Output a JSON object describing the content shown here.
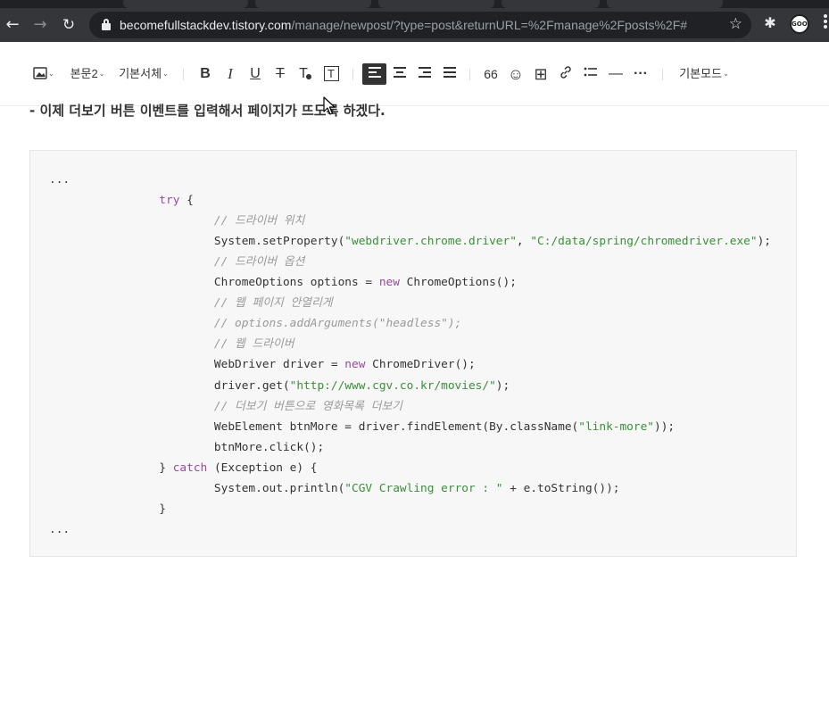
{
  "browser": {
    "url_host": "becomefullstackdev.tistory.com",
    "url_path": "/manage/newpost/?type=post&returnURL=%2Fmanage%2Fposts%2F#",
    "profile_label": "GOOD",
    "icons": {
      "back": "back-arrow-icon",
      "forward": "forward-arrow-icon",
      "reload": "reload-icon",
      "lock": "lock-icon",
      "bookmark": "star-icon",
      "extensions": "puzzle-icon",
      "menu": "kebab-menu-icon"
    }
  },
  "toolbar": {
    "paragraph_style": "본문2",
    "font_family": "기본서체",
    "mode": "기본모드",
    "bold": "B",
    "italic": "I",
    "underline": "U",
    "strike": "T",
    "text_color": "T",
    "text_bg": "T",
    "quote": "66",
    "emoji": "☺",
    "table": "⊞",
    "link": "🔗",
    "list": "☰",
    "divider": "—",
    "more": "···"
  },
  "content": {
    "heading_text": "- 이제 더보기 버튼 이벤트를 입력해서 페이지가 뜨도록 하겠다.",
    "code_lines": [
      {
        "indent": "",
        "parts": [
          {
            "t": "...",
            "c": ""
          }
        ]
      },
      {
        "indent": "                ",
        "parts": [
          {
            "t": "try",
            "c": "kw"
          },
          {
            "t": " {",
            "c": ""
          }
        ]
      },
      {
        "indent": "                        ",
        "parts": [
          {
            "t": "// 드라이버 위치",
            "c": "cm"
          }
        ]
      },
      {
        "indent": "                        ",
        "parts": [
          {
            "t": "System.setProperty(",
            "c": ""
          },
          {
            "t": "\"webdriver.chrome.driver\"",
            "c": "str"
          },
          {
            "t": ", ",
            "c": ""
          },
          {
            "t": "\"C:/data/spring/chromedriver.exe\"",
            "c": "str"
          },
          {
            "t": ");",
            "c": ""
          }
        ]
      },
      {
        "indent": "                        ",
        "parts": [
          {
            "t": "// 드라이버 옵션",
            "c": "cm"
          }
        ]
      },
      {
        "indent": "                        ",
        "parts": [
          {
            "t": "ChromeOptions options = ",
            "c": ""
          },
          {
            "t": "new",
            "c": "kw"
          },
          {
            "t": " ChromeOptions();",
            "c": ""
          }
        ]
      },
      {
        "indent": "                        ",
        "parts": [
          {
            "t": "// 웹 페이지 안열리게",
            "c": "cm"
          }
        ]
      },
      {
        "indent": "                        ",
        "parts": [
          {
            "t": "// options.addArguments(\"headless\");",
            "c": "cm"
          }
        ]
      },
      {
        "indent": "                        ",
        "parts": [
          {
            "t": "// 웹 드라이버",
            "c": "cm"
          }
        ]
      },
      {
        "indent": "                        ",
        "parts": [
          {
            "t": "WebDriver driver = ",
            "c": ""
          },
          {
            "t": "new",
            "c": "kw"
          },
          {
            "t": " ChromeDriver();",
            "c": ""
          }
        ]
      },
      {
        "indent": "                        ",
        "parts": [
          {
            "t": "driver.get(",
            "c": ""
          },
          {
            "t": "\"http://www.cgv.co.kr/movies/\"",
            "c": "str"
          },
          {
            "t": ");",
            "c": ""
          }
        ]
      },
      {
        "indent": "                        ",
        "parts": [
          {
            "t": "// 더보기 버튼으로 영화목록 더보기",
            "c": "cm"
          }
        ]
      },
      {
        "indent": "                        ",
        "parts": [
          {
            "t": "WebElement btnMore = driver.findElement(By.className(",
            "c": ""
          },
          {
            "t": "\"link-more\"",
            "c": "str"
          },
          {
            "t": "));",
            "c": ""
          }
        ]
      },
      {
        "indent": "                        ",
        "parts": [
          {
            "t": "btnMore.click();",
            "c": ""
          }
        ]
      },
      {
        "indent": "                ",
        "parts": [
          {
            "t": "} ",
            "c": ""
          },
          {
            "t": "catch",
            "c": "kw"
          },
          {
            "t": " (Exception e) {",
            "c": ""
          }
        ]
      },
      {
        "indent": "                        ",
        "parts": [
          {
            "t": "System.out.println(",
            "c": ""
          },
          {
            "t": "\"CGV Crawling error : \"",
            "c": "str"
          },
          {
            "t": " + e.toString());",
            "c": ""
          }
        ]
      },
      {
        "indent": "                ",
        "parts": [
          {
            "t": "}",
            "c": ""
          }
        ]
      },
      {
        "indent": "",
        "parts": [
          {
            "t": "...",
            "c": ""
          }
        ]
      }
    ]
  },
  "colors": {
    "keyword": "#9a4aa0",
    "string": "#3a8f3a",
    "comment": "#9a9a9a",
    "code_bg": "#f7f7f7",
    "chrome_dark": "#35363a"
  }
}
